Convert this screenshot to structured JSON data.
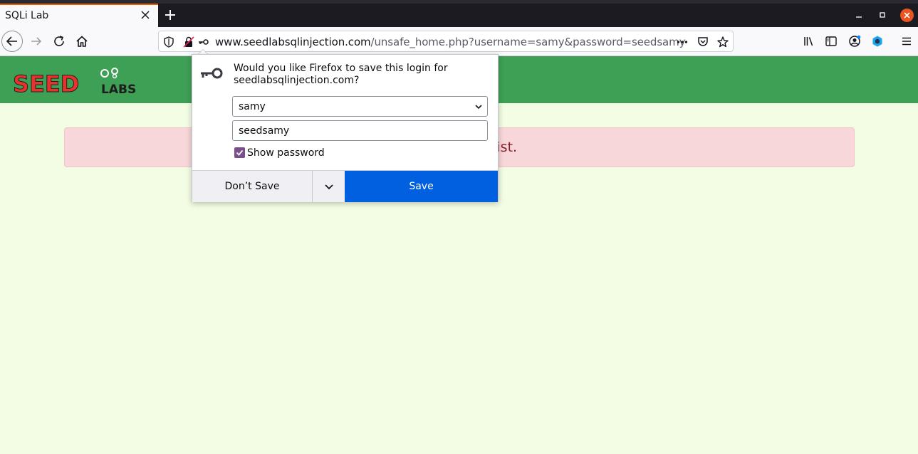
{
  "browser": {
    "tab_title": "SQLi Lab",
    "url_host": "www.seedlabsqlinjection.com",
    "url_path": "/unsafe_home.php?username=samy&password=seedsamy"
  },
  "page": {
    "logo_text_main": "SEED",
    "logo_text_sub": "LABS",
    "alert_text": "rovide does not exist."
  },
  "save_login_popup": {
    "message": "Would you like Firefox to save this login for seedlabsqlinjection.com?",
    "username_value": "samy",
    "password_value": "seedsamy",
    "show_password_label": "Show password",
    "show_password_checked": true,
    "dont_save_label": "Don’t Save",
    "save_label": "Save"
  },
  "colors": {
    "header_green": "#3ea055",
    "alert_bg": "#f8d7da",
    "alert_text": "#842029",
    "save_button": "#0060df",
    "page_bg": "#f3fde4"
  },
  "icons": [
    "close-icon",
    "plus-icon",
    "minimize-icon",
    "restore-icon",
    "back-arrow-icon",
    "forward-arrow-icon",
    "reload-icon",
    "home-icon",
    "shield-icon",
    "insecure-lock-icon",
    "key-icon",
    "more-dots-icon",
    "pocket-icon",
    "star-icon",
    "library-icon",
    "sidebar-icon",
    "account-icon",
    "extension-icon",
    "hamburger-menu-icon",
    "chevron-down-icon"
  ]
}
